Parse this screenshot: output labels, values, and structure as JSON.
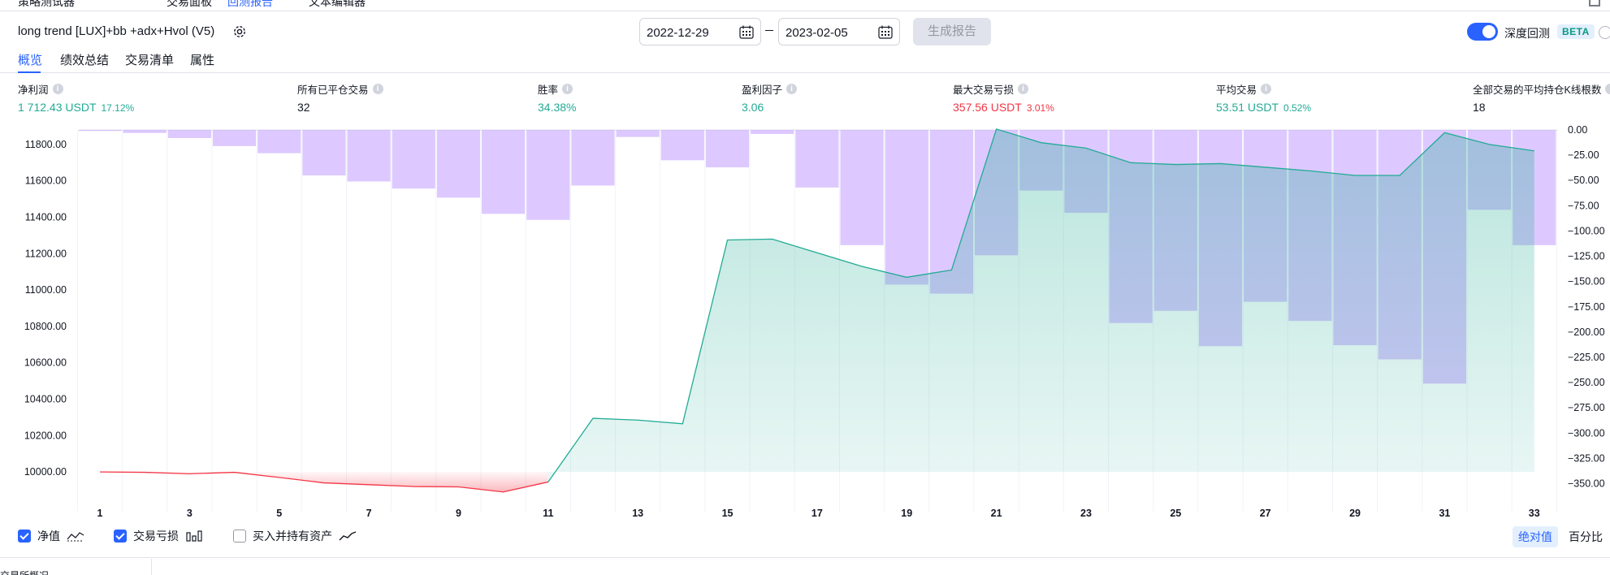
{
  "top_strip": {
    "tabs": [
      "策略测试器",
      "交易面板",
      "回测报告",
      "文本编辑器"
    ]
  },
  "header": {
    "strategy_name": "long trend [LUX]+bb +adx+Hvol (V5)",
    "start_date": "2022-12-29",
    "end_date": "2023-02-05",
    "generate_report": "生成报告",
    "deep_backtest_label": "深度回测",
    "deep_backtest_on": true,
    "beta_badge": "BETA"
  },
  "tabs": [
    {
      "label": "概览",
      "active": true
    },
    {
      "label": "绩效总结",
      "active": false
    },
    {
      "label": "交易清单",
      "active": false
    },
    {
      "label": "属性",
      "active": false
    }
  ],
  "metrics": [
    {
      "label": "净利润",
      "value": "1 712.43 USDT",
      "pct": "17.12%",
      "color": "green"
    },
    {
      "label": "所有已平仓交易",
      "value": "32",
      "pct": "",
      "color": "dark"
    },
    {
      "label": "胜率",
      "value": "34.38%",
      "pct": "",
      "color": "green"
    },
    {
      "label": "盈利因子",
      "value": "3.06",
      "pct": "",
      "color": "green"
    },
    {
      "label": "最大交易亏损",
      "value": "357.56 USDT",
      "pct": "3.01%",
      "color": "red"
    },
    {
      "label": "平均交易",
      "value": "53.51 USDT",
      "pct": "0.52%",
      "color": "green"
    },
    {
      "label": "全部交易的平均持仓K线根数",
      "value": "18",
      "pct": "",
      "color": "dark"
    }
  ],
  "chart_data": {
    "type": "area",
    "x_ticks": [
      1,
      3,
      5,
      7,
      9,
      11,
      13,
      15,
      17,
      19,
      21,
      23,
      25,
      27,
      29,
      31,
      33
    ],
    "y_left_ticks": [
      "10000.00",
      "10200.00",
      "10400.00",
      "10600.00",
      "10800.00",
      "11000.00",
      "11200.00",
      "11400.00",
      "11600.00",
      "11800.00"
    ],
    "y_right_ticks": [
      "0.00",
      "−25.00",
      "−50.00",
      "−75.00",
      "−100.00",
      "−125.00",
      "−150.00",
      "−175.00",
      "−200.00",
      "−225.00",
      "−250.00",
      "−275.00",
      "−300.00",
      "−325.00",
      "−350.00"
    ],
    "ylim_left": [
      9880,
      11880
    ],
    "ylim_right": [
      -360,
      0
    ],
    "series": [
      {
        "name": "净值",
        "x": [
          1,
          2,
          3,
          4,
          5,
          6,
          7,
          8,
          9,
          10,
          11,
          12,
          13,
          14,
          15,
          16,
          17,
          18,
          19,
          20,
          21,
          22,
          23,
          24,
          25,
          26,
          27,
          28,
          29,
          30,
          31,
          32,
          33
        ],
        "values": [
          10000,
          9998,
          9990,
          9998,
          9970,
          9940,
          9930,
          9920,
          9918,
          9890,
          9945,
          10295,
          10285,
          10265,
          11275,
          11280,
          11205,
          11130,
          11070,
          11110,
          11885,
          11810,
          11780,
          11700,
          11690,
          11695,
          11675,
          11655,
          11630,
          11630,
          11865,
          11800,
          11765
        ]
      },
      {
        "name": "交易亏损",
        "x": [
          1,
          2,
          3,
          4,
          5,
          6,
          7,
          8,
          9,
          10,
          11,
          12,
          13,
          14,
          15,
          16,
          17,
          18,
          19,
          20,
          21,
          22,
          23,
          24,
          25,
          26,
          27,
          28,
          29,
          30,
          31,
          32,
          33
        ],
        "values": [
          0,
          -3,
          -8,
          -16,
          -23,
          -45,
          -51,
          -58,
          -67,
          -83,
          -89,
          -55,
          -7,
          -30,
          -37,
          -4,
          -57,
          -114,
          -153,
          -162,
          -124,
          -60,
          -82,
          -191,
          -179,
          -214,
          -170,
          -189,
          -213,
          -227,
          -251,
          -79,
          -114
        ]
      }
    ],
    "colors": {
      "equity_up": "#22ab94",
      "equity_down": "#f23645",
      "drawdown": "#b388ff"
    }
  },
  "legend": {
    "items": [
      {
        "label": "净值",
        "checked": true
      },
      {
        "label": "交易亏损",
        "checked": true
      },
      {
        "label": "买入并持有资产",
        "checked": false
      }
    ],
    "mode_absolute": "绝对值",
    "mode_percent": "百分比"
  },
  "footer": {
    "text": "交易所概况"
  }
}
